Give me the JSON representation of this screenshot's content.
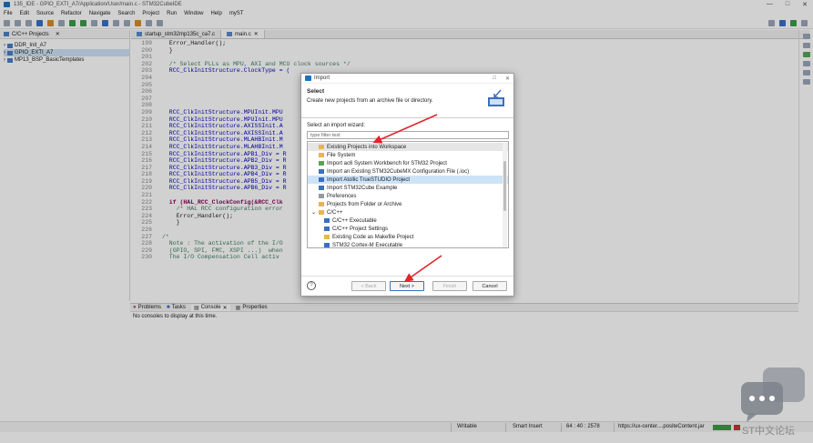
{
  "window": {
    "title": "135_IDE - GPIO_EXTI_A7/Application/User/main.c - STM32CubeIDE",
    "controls": [
      "—",
      "□",
      "✕"
    ]
  },
  "menu": [
    "File",
    "Edit",
    "Source",
    "Refactor",
    "Navigate",
    "Search",
    "Project",
    "Run",
    "Window",
    "Help",
    "myST"
  ],
  "left_panel": {
    "tab_label": "C/C++ Projects",
    "projects": [
      {
        "label": "DDR_Init_A7"
      },
      {
        "label": "GPIO_EXTI_A7"
      },
      {
        "label": "MP13_BSP_BasicTemplates"
      }
    ]
  },
  "editor": {
    "tabs": [
      {
        "label": "startup_stm32mp135c_ca7.c"
      },
      {
        "label": "main.c"
      }
    ],
    "line_numbers": [
      "199",
      "200",
      "201",
      "202",
      "203",
      "204",
      "205",
      "206",
      "207",
      "208",
      "209",
      "210",
      "211",
      "212",
      "213",
      "214",
      "215",
      "216",
      "217",
      "218",
      "219",
      "220",
      "221",
      "222",
      "223",
      "224",
      "225",
      "226",
      "227",
      "228",
      "229",
      "230"
    ],
    "lines": [
      "  Error_Handler();",
      "  }",
      "",
      "  /* Select PLLs as MPU, AXI and MCU clock sources */",
      "  RCC_ClkInitStructure.ClockType = (",
      "",
      "",
      "",
      "",
      "",
      "  RCC_ClkInitStructure.MPUInit.MPU",
      "  RCC_ClkInitStructure.MPUInit.MPU",
      "  RCC_ClkInitStructure.AXISSInit.A",
      "  RCC_ClkInitStructure.AXISSInit.A",
      "  RCC_ClkInitStructure.MLAHBInit.M",
      "  RCC_ClkInitStructure.MLAHBInit.M",
      "  RCC_ClkInitStructure.APB1_Div = R",
      "  RCC_ClkInitStructure.APB2_Div = R",
      "  RCC_ClkInitStructure.APB3_Div = R",
      "  RCC_ClkInitStructure.APB4_Div = R",
      "  RCC_ClkInitStructure.APB5_Div = R",
      "  RCC_ClkInitStructure.APB6_Div = R",
      "",
      "  if (HAL_RCC_ClockConfig(&RCC_Clk",
      "    /* HAL RCC configuration error",
      "    Error_Handler();",
      "    }",
      "",
      "/*",
      "  Note : The activation of the I/O                                              n  interfaces",
      "  (GPIO, SPI, FMC, XSPI ...)  when                                           roduct datasheet)",
      "  The I/O Compensation Cell activ"
    ]
  },
  "bottom_panel": {
    "tabs": [
      {
        "label": "Problems"
      },
      {
        "label": "Tasks"
      },
      {
        "label": "Console"
      },
      {
        "label": "Properties"
      }
    ],
    "console_message": "No consoles to display at this time."
  },
  "status_bar": {
    "writable": "Writable",
    "insert_mode": "Smart Insert",
    "position": "64 : 40 : 2578",
    "url": "https://ux-center....positeContent.jar"
  },
  "dialog": {
    "title": "Import",
    "header_title": "Select",
    "header_desc": "Create new projects from an archive file or directory.",
    "wizard_label": "Select an import wizard:",
    "filter_placeholder": "type filter text",
    "items": [
      {
        "label": "Existing Projects into Workspace",
        "icon": "folder-icon"
      },
      {
        "label": "File System",
        "icon": "folder-icon"
      },
      {
        "label": "Import ac6 System Workbench for STM32 Project",
        "icon": "ac6-icon"
      },
      {
        "label": "Import an Existing STM32CubeMX Configuration File (.ioc)",
        "icon": "cubemx-icon"
      },
      {
        "label": "Import Atollic TrueSTUDIO Project",
        "icon": "atollic-icon"
      },
      {
        "label": "Import STM32Cube Example",
        "icon": "cube-icon"
      },
      {
        "label": "Preferences",
        "icon": "preferences-icon"
      },
      {
        "label": "Projects from Folder or Archive",
        "icon": "folder-icon"
      }
    ],
    "category": "C/C++",
    "sub_items": [
      {
        "label": "C/C++ Executable"
      },
      {
        "label": "C/C++ Project Settings"
      },
      {
        "label": "Existing Code as Makefile Project"
      },
      {
        "label": "STM32 Cortex-M Executable"
      }
    ],
    "buttons": {
      "back": "< Back",
      "next": "Next >",
      "finish": "Finish",
      "cancel": "Cancel"
    }
  },
  "watermark": {
    "text": "ST中文论坛"
  },
  "colors": {
    "arrow": "#e0242a",
    "selection": "#cde3f7",
    "accent": "#3a6fc4"
  }
}
